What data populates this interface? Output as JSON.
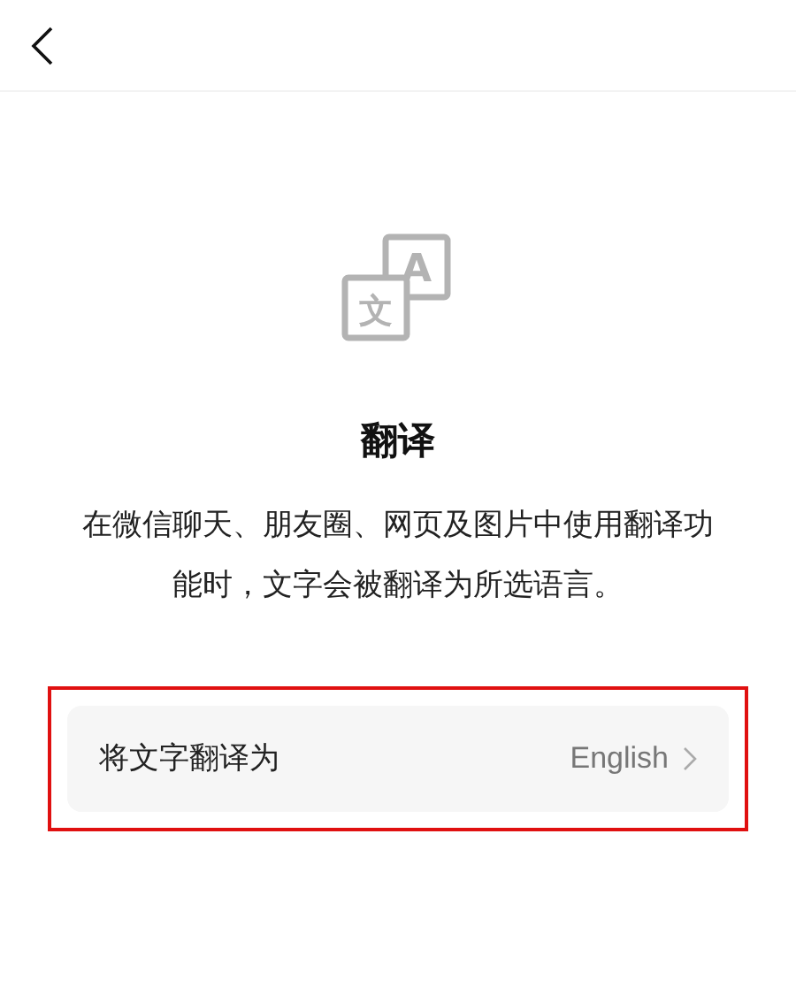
{
  "icon": {
    "glyphs": [
      "A",
      "文"
    ]
  },
  "title": "翻译",
  "description": "在微信聊天、朋友圈、网页及图片中使用翻译功能时，文字会被翻译为所选语言。",
  "setting": {
    "label": "将文字翻译为",
    "value": "English",
    "highlighted": true
  }
}
